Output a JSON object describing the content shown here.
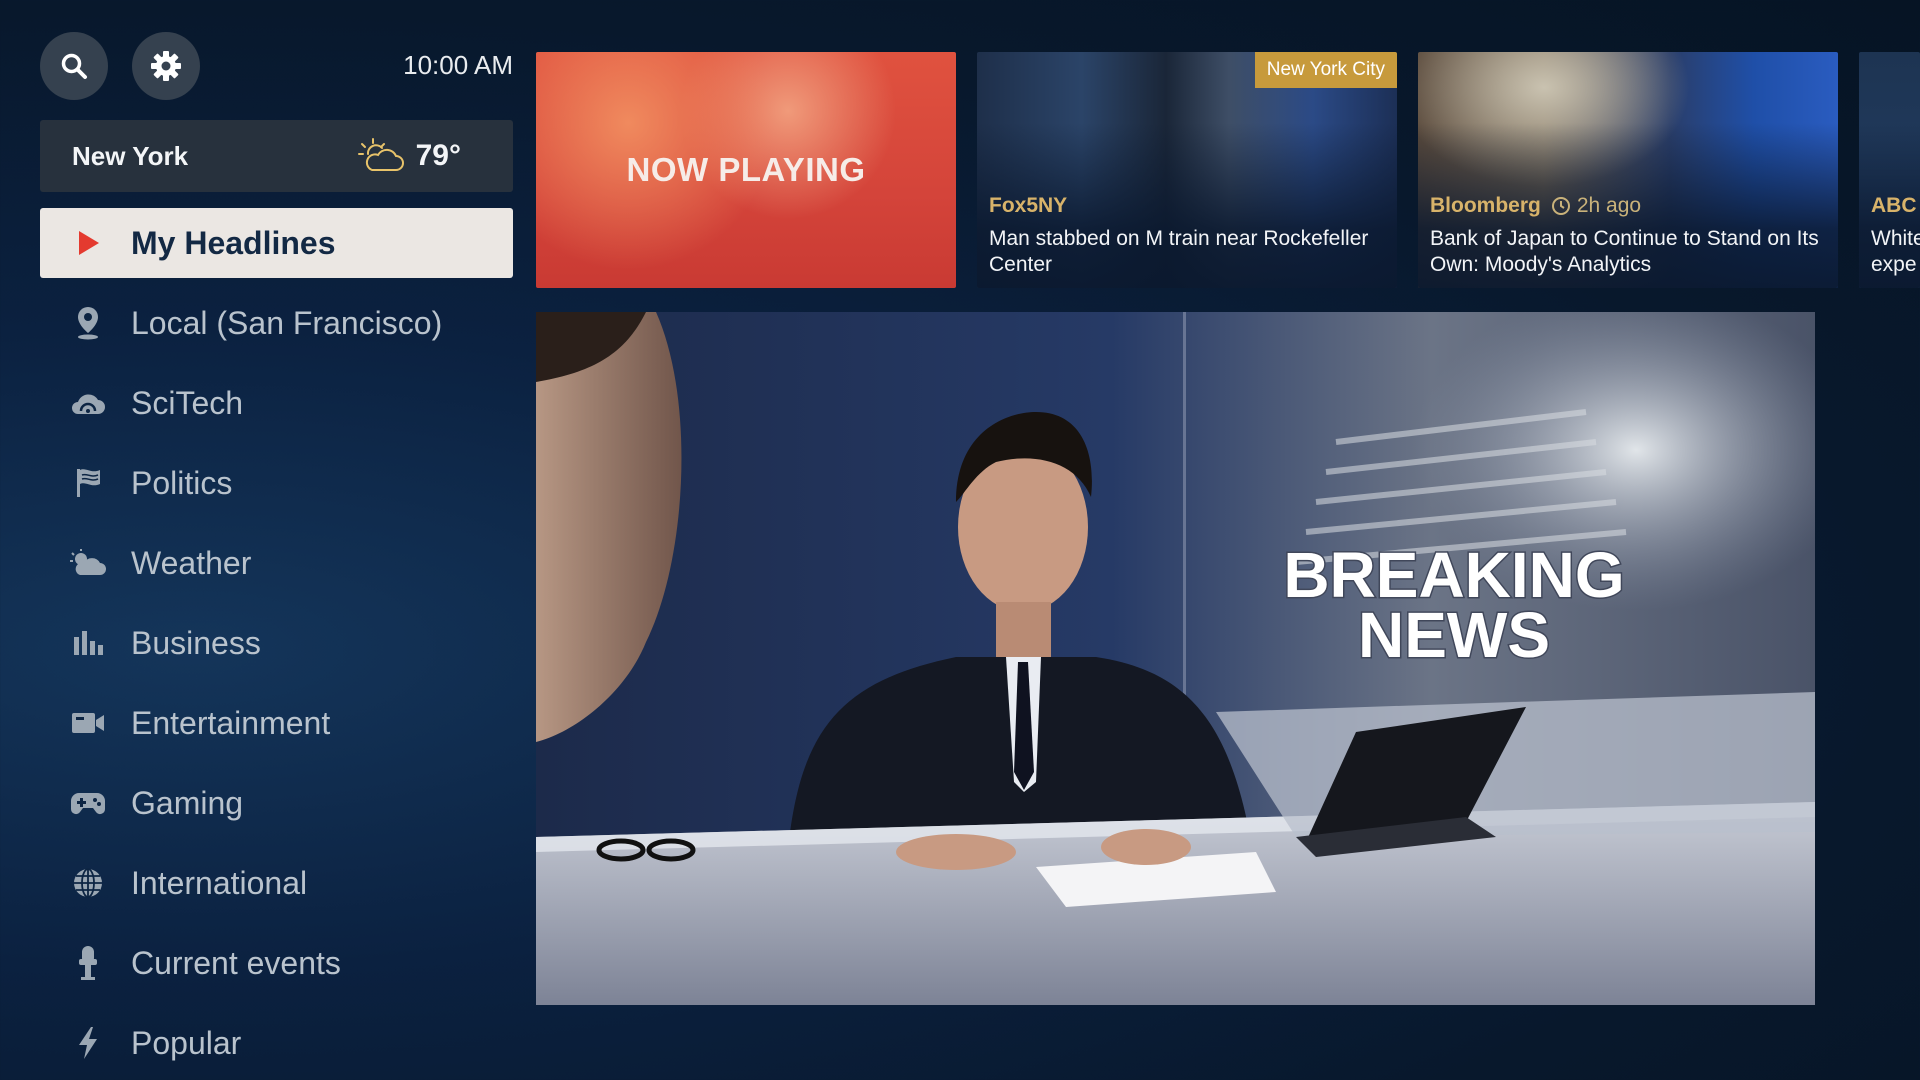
{
  "header": {
    "time": "10:00 AM"
  },
  "weather": {
    "city": "New York",
    "temperature": "79°",
    "icon": "partly-cloudy-icon"
  },
  "menu": [
    {
      "label": "My Headlines",
      "icon": "play-icon",
      "active": true
    },
    {
      "label": "Local (San Francisco)",
      "icon": "location-pin-icon"
    },
    {
      "label": "SciTech",
      "icon": "cloud-icon"
    },
    {
      "label": "Politics",
      "icon": "flag-icon"
    },
    {
      "label": "Weather",
      "icon": "weather-icon"
    },
    {
      "label": "Business",
      "icon": "bar-chart-icon"
    },
    {
      "label": "Entertainment",
      "icon": "video-camera-icon"
    },
    {
      "label": "Gaming",
      "icon": "gamepad-icon"
    },
    {
      "label": "International",
      "icon": "globe-icon"
    },
    {
      "label": "Current events",
      "icon": "microphone-icon"
    },
    {
      "label": "Popular",
      "icon": "lightning-icon"
    }
  ],
  "cards": [
    {
      "label": "NOW PLAYING"
    },
    {
      "source": "Fox5NY",
      "tag": "New York City",
      "title": "Man stabbed on M train near Rockefeller Center"
    },
    {
      "source": "Bloomberg",
      "time": "2h ago",
      "title": "Bank of Japan to Continue to Stand on Its Own: Moody's Analytics"
    },
    {
      "source": "ABC",
      "title": "White expe"
    }
  ],
  "player": {
    "overlay_text_1": "BREAKING",
    "overlay_text_2": "NEWS"
  },
  "colors": {
    "background": "#0b2140",
    "active_item_bg": "#ebe7e3",
    "now_playing_red": "#d9473a",
    "source_gold": "#d8b36a",
    "tag_gold": "#c79a3c"
  }
}
